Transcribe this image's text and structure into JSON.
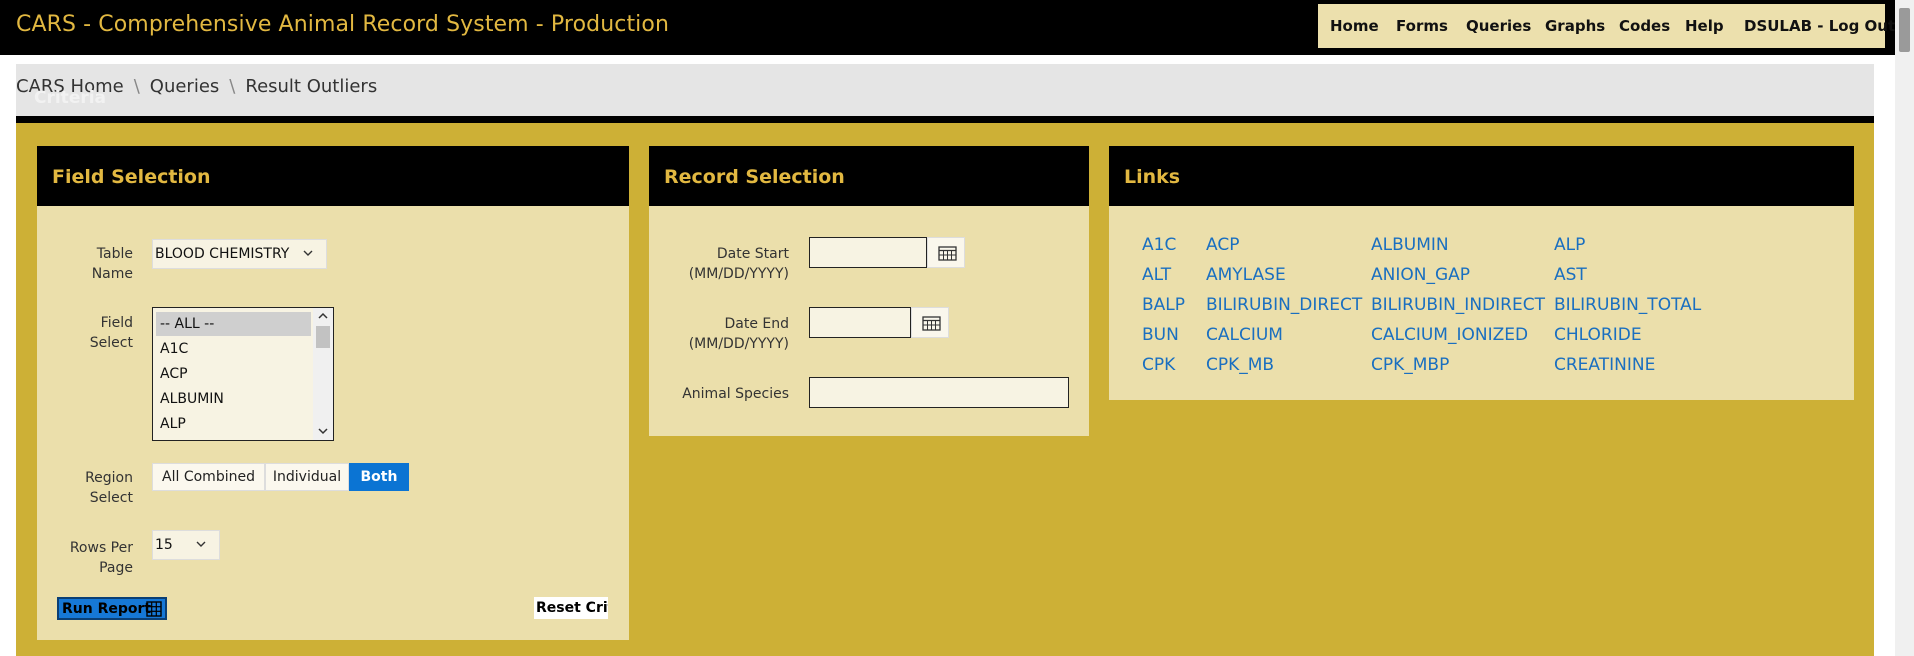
{
  "app": {
    "title": "CARS - Comprehensive Animal Record System - Production"
  },
  "topnav": {
    "items": [
      "Home",
      "Forms",
      "Queries",
      "Graphs",
      "Codes",
      "Help",
      "DSULAB - Log Out"
    ]
  },
  "breadcrumb": {
    "items": [
      "CARS Home",
      "Queries",
      "Result Outliers"
    ],
    "ghost_heading": "Criteria"
  },
  "field_selection": {
    "title": "Field Selection",
    "table_name_label": "Table Name",
    "table_name_value": "BLOOD CHEMISTRY",
    "field_select_label": "Field Select",
    "field_options": [
      "-- ALL --",
      "A1C",
      "ACP",
      "ALBUMIN",
      "ALP"
    ],
    "region_select_label": "Region Select",
    "region_options": [
      "All Combined",
      "Individual",
      "Both"
    ],
    "region_selected": "Both",
    "rows_per_page_label": "Rows Per Page",
    "rows_per_page_value": "15",
    "run_report_label": "Run Report",
    "reset_label": "Reset Criteria"
  },
  "record_selection": {
    "title": "Record Selection",
    "date_start_label": "Date Start (MM/DD/YYYY)",
    "date_end_label": "Date End (MM/DD/YYYY)",
    "animal_species_label": "Animal Species",
    "date_start_value": "",
    "date_end_value": "",
    "animal_species_value": ""
  },
  "links": {
    "title": "Links",
    "rows": [
      [
        "A1C",
        "ACP",
        "ALBUMIN",
        "ALP"
      ],
      [
        "ALT",
        "AMYLASE",
        "ANION_GAP",
        "AST"
      ],
      [
        "BALP",
        "BILIRUBIN_DIRECT",
        "BILIRUBIN_INDIRECT",
        "BILIRUBIN_TOTAL"
      ],
      [
        "BUN",
        "CALCIUM",
        "CALCIUM_IONIZED",
        "CHLORIDE"
      ],
      [
        "CPK",
        "CPK_MB",
        "CPK_MBP",
        "CREATININE"
      ]
    ]
  },
  "colors": {
    "gold": "#cdb036",
    "panel": "#ebdfab",
    "title_gold": "#e2b841",
    "link_blue": "#1a6fc0",
    "active_blue": "#0b74d3"
  }
}
